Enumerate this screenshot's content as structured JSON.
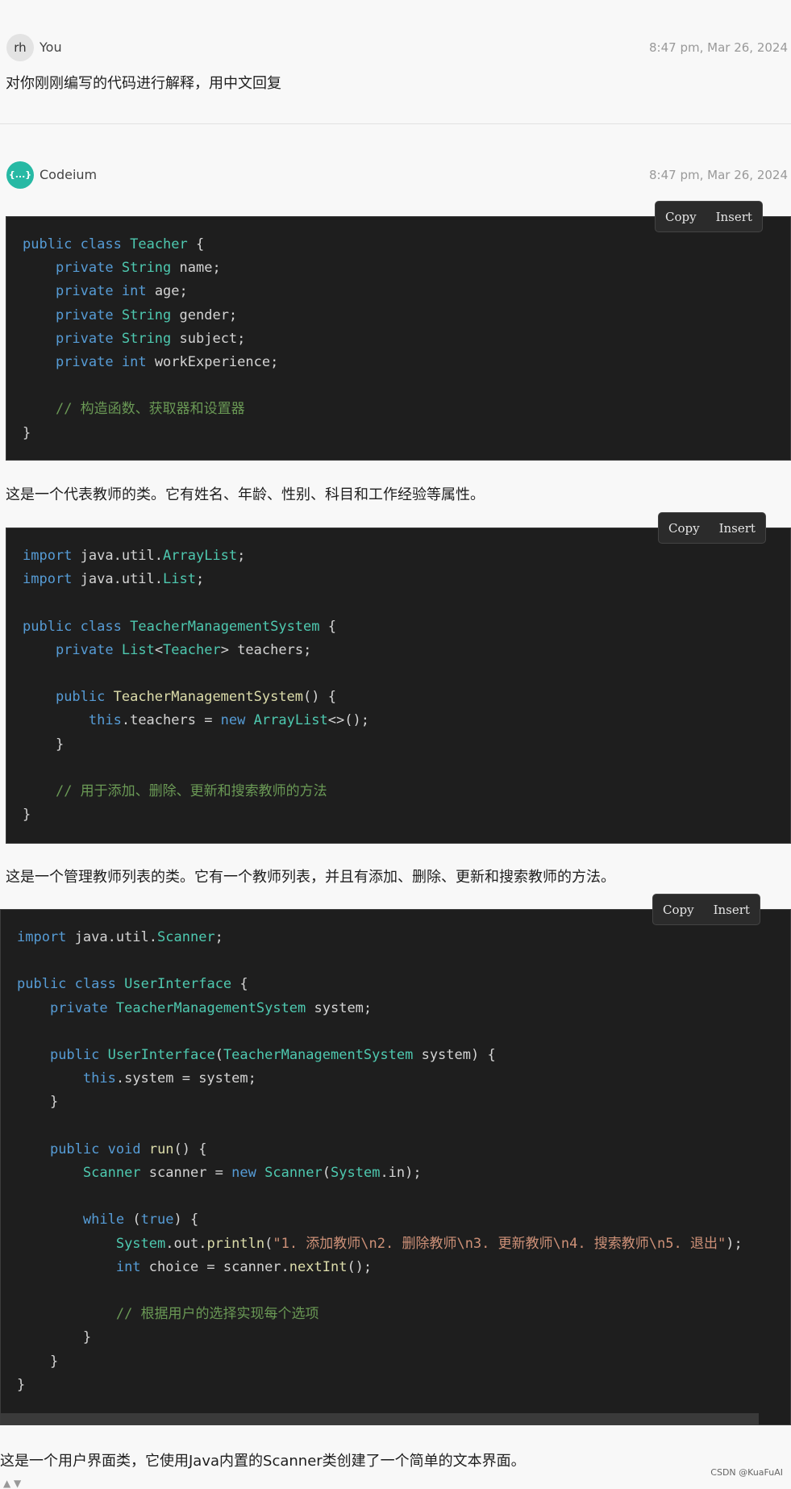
{
  "user_message": {
    "avatar_initials": "rh",
    "author": "You",
    "timestamp": "8:47 pm, Mar 26, 2024",
    "text": "对你刚刚编写的代码进行解释，用中文回复"
  },
  "assistant_message": {
    "avatar_label": "{...}",
    "author": "Codeium",
    "timestamp": "8:47 pm, Mar 26, 2024",
    "copy_label": "Copy",
    "insert_label": "Insert",
    "code_blocks": [
      {
        "lines": [
          "public class Teacher {",
          "    private String name;",
          "    private int age;",
          "    private String gender;",
          "    private String subject;",
          "    private int workExperience;",
          "",
          "    // 构造函数、获取器和设置器",
          "}"
        ]
      },
      {
        "lines": [
          "import java.util.ArrayList;",
          "import java.util.List;",
          "",
          "public class TeacherManagementSystem {",
          "    private List<Teacher> teachers;",
          "",
          "    public TeacherManagementSystem() {",
          "        this.teachers = new ArrayList<>();",
          "    }",
          "",
          "    // 用于添加、删除、更新和搜索教师的方法",
          "}"
        ]
      },
      {
        "lines": [
          "import java.util.Scanner;",
          "",
          "public class UserInterface {",
          "    private TeacherManagementSystem system;",
          "",
          "    public UserInterface(TeacherManagementSystem system) {",
          "        this.system = system;",
          "    }",
          "",
          "    public void run() {",
          "        Scanner scanner = new Scanner(System.in);",
          "",
          "        while (true) {",
          "            System.out.println(\"1. 添加教师\\n2. 删除教师\\n3. 更新教师\\n4. 搜索教师\\n5. 退出\");",
          "            int choice = scanner.nextInt();",
          "",
          "            // 根据用户的选择实现每个选项",
          "        }",
          "    }",
          "}"
        ]
      }
    ],
    "explanations": [
      "这是一个代表教师的类。它有姓名、年龄、性别、科目和工作经验等属性。",
      "这是一个管理教师列表的类。它有一个教师列表，并且有添加、删除、更新和搜索教师的方法。",
      "这是一个用户界面类，它使用Java内置的Scanner类创建了一个简单的文本界面。"
    ]
  },
  "watermark": "CSDN @KuaFuAI",
  "colors": {
    "keyword": "#569cd6",
    "type": "#4ec9b0",
    "function": "#dcdcaa",
    "string": "#ce9178",
    "comment": "#6a9955",
    "code_bg": "#1e1e1e"
  }
}
